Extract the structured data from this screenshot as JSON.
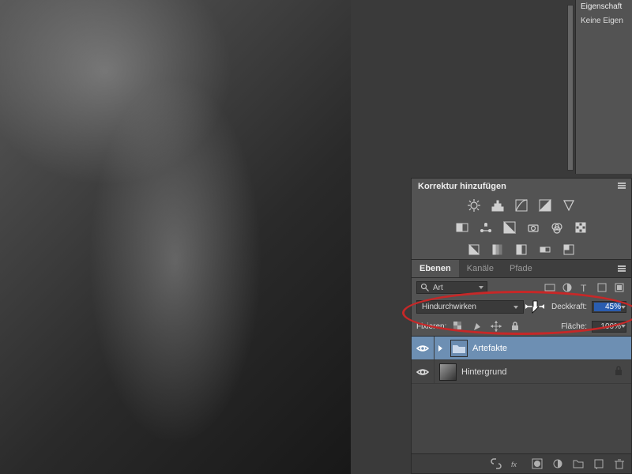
{
  "properties_panel": {
    "title": "Eigenschaft",
    "body": "Keine Eigen"
  },
  "adjust_panel": {
    "title": "Korrektur hinzufügen"
  },
  "layers_panel": {
    "tabs": {
      "layers": "Ebenen",
      "channels": "Kanäle",
      "paths": "Pfade"
    },
    "filter_label": "Art",
    "blend_mode": "Hindurchwirken",
    "opacity_label": "Deckkraft:",
    "opacity_value": "45%",
    "lock_label": "Fixieren:",
    "fill_label": "Fläche:",
    "fill_value": "100%",
    "layers": [
      {
        "name": "Artefakte",
        "type": "folder",
        "selected": true,
        "visible": true
      },
      {
        "name": "Hintergrund",
        "type": "image",
        "selected": false,
        "visible": true,
        "locked": true
      }
    ]
  }
}
